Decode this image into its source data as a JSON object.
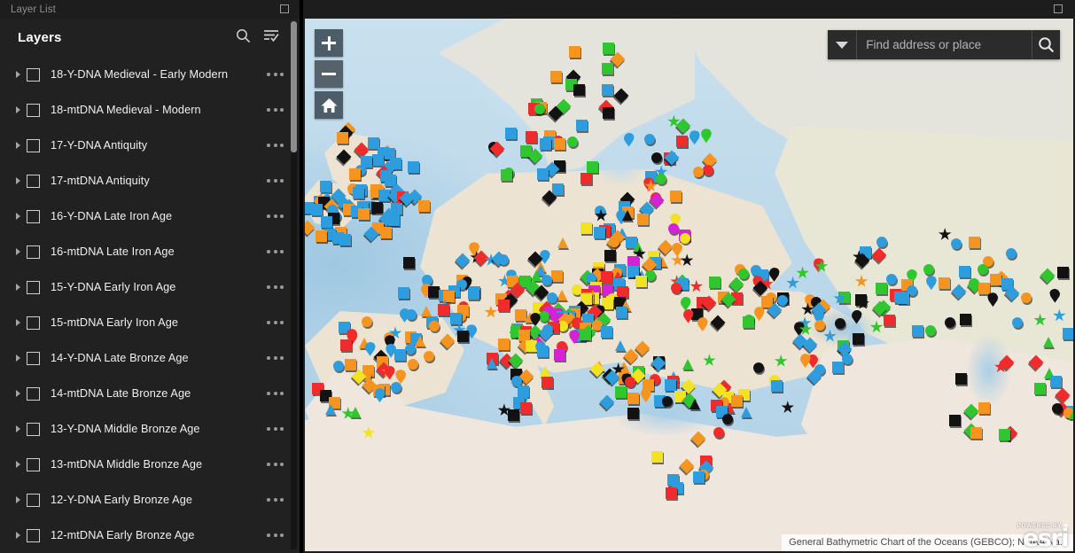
{
  "panel": {
    "titlebar": "Layer List",
    "maximize_icon": "maximize-square-icon",
    "header_title": "Layers",
    "search_icon": "search-icon",
    "filter_icon": "filter-list-icon",
    "row_menu_icon": "ellipsis-menu-icon",
    "expand_icon": "chevron-right-icon",
    "checkbox_icon": "checkbox-unchecked-icon",
    "layers": [
      {
        "label": "18-Y-DNA Medieval - Early Modern",
        "checked": false
      },
      {
        "label": "18-mtDNA Medieval - Modern",
        "checked": false
      },
      {
        "label": "17-Y-DNA Antiquity",
        "checked": false
      },
      {
        "label": "17-mtDNA Antiquity",
        "checked": false
      },
      {
        "label": "16-Y-DNA Late Iron Age",
        "checked": false
      },
      {
        "label": "16-mtDNA Late Iron Age",
        "checked": false
      },
      {
        "label": "15-Y-DNA Early Iron Age",
        "checked": false
      },
      {
        "label": "15-mtDNA Early Iron Age",
        "checked": false
      },
      {
        "label": "14-Y-DNA Late Bronze Age",
        "checked": false
      },
      {
        "label": "14-mtDNA Late Bronze Age",
        "checked": false
      },
      {
        "label": "13-Y-DNA Middle Bronze Age",
        "checked": false
      },
      {
        "label": "13-mtDNA Middle Bronze Age",
        "checked": false
      },
      {
        "label": "12-Y-DNA Early Bronze Age",
        "checked": false
      },
      {
        "label": "12-mtDNA Early Bronze Age",
        "checked": false
      }
    ]
  },
  "map": {
    "titlebar": "",
    "maximize_icon": "maximize-square-icon",
    "zoom_in_label": "+",
    "zoom_out_label": "−",
    "home_icon": "home-icon",
    "zoom_in_icon": "plus-icon",
    "zoom_out_icon": "minus-icon",
    "search": {
      "placeholder": "Find address or place",
      "value": "",
      "dropdown_icon": "chevron-down-icon",
      "submit_icon": "search-icon"
    },
    "attribution": "General Bathymetric Chart of the Oceans (GEBCO); NOAA Na...",
    "logo": {
      "powered_by": "POWERED BY",
      "wordmark": "esri"
    },
    "marker_colors": {
      "blue": "#2e9ddd",
      "orange": "#f5941f",
      "green": "#2fc62f",
      "black": "#121212",
      "red": "#ef2b2b",
      "yellow": "#f2e221",
      "magenta": "#d422d4",
      "brown": "#9c6b3c",
      "pink": "#ff9bd0"
    },
    "basemap_colors": {
      "ocean": "#b2d2e7",
      "land": "#ece3d2",
      "desert": "#f0e8da"
    }
  }
}
